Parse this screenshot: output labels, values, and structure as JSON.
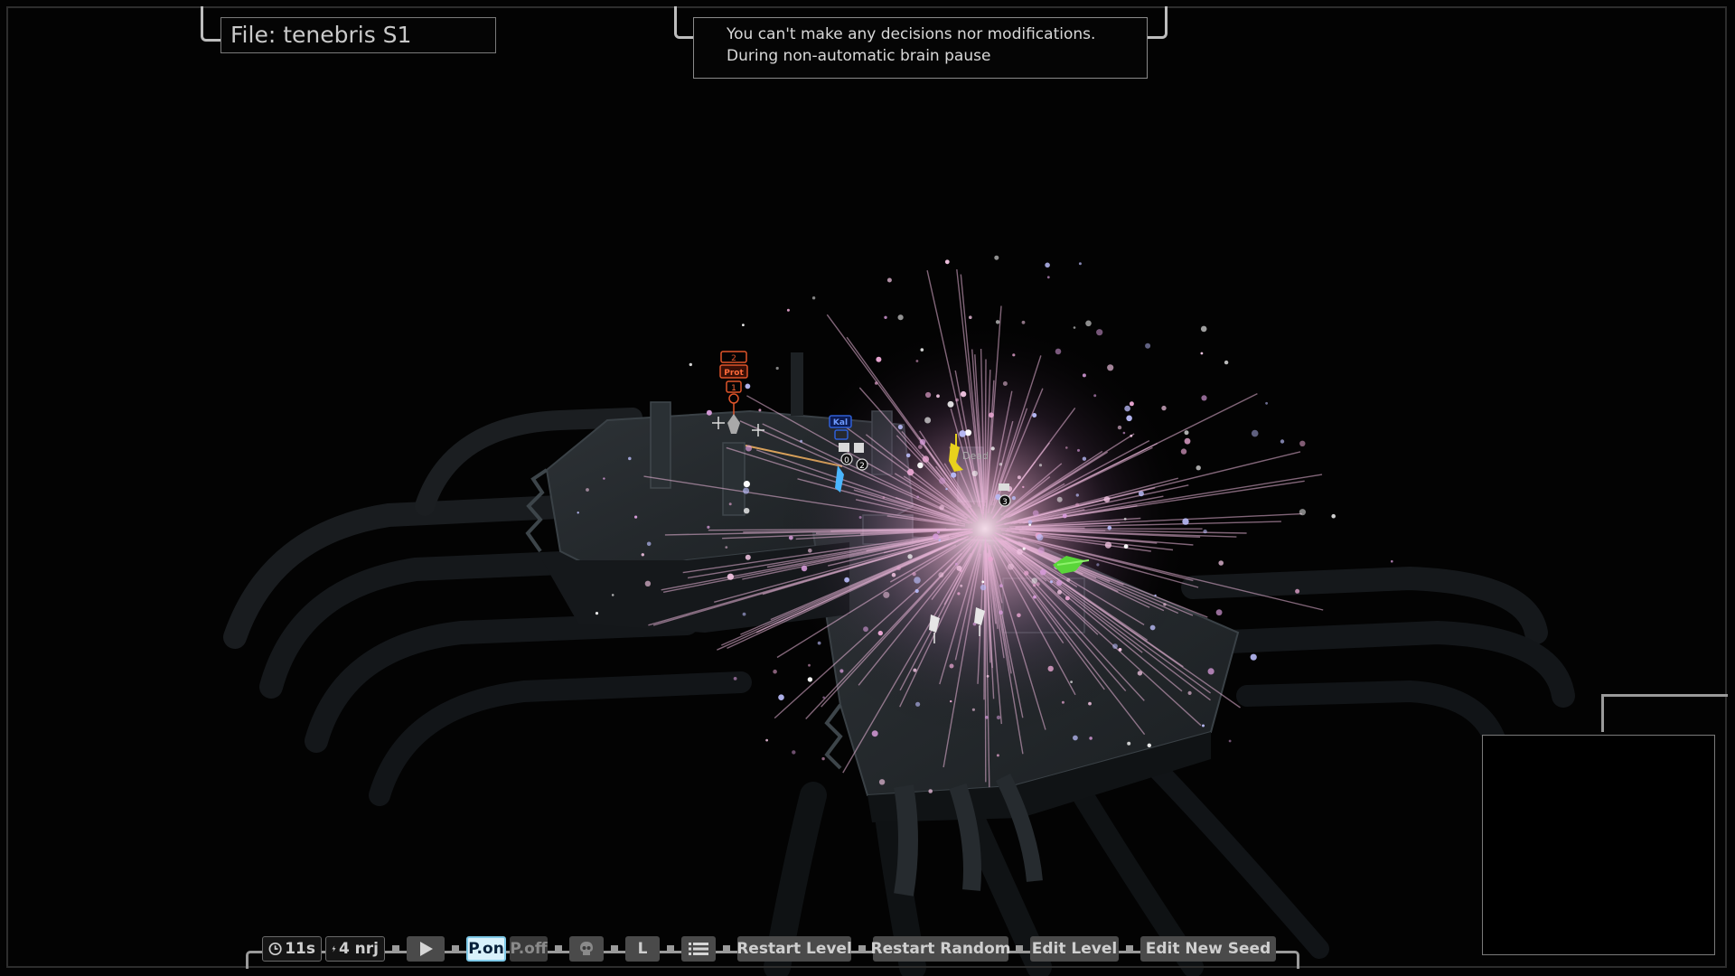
{
  "file_title": "File: tenebris S1",
  "message": {
    "line1": "You can't make any decisions nor modifications.",
    "line2": "During non-automatic brain pause"
  },
  "toolbar": {
    "time_label": "11s",
    "energy_label": "4 nrj",
    "play_icon": "play-icon",
    "pause_on_label": "P.on",
    "pause_off_label": "P.off",
    "skull_icon": "skull-icon",
    "l_label": "L",
    "list_icon": "list-icon",
    "restart_level_label": "Restart Level",
    "restart_random_label": "Restart Random",
    "edit_level_label": "Edit Level",
    "edit_new_seed_label": "Edit New Seed"
  },
  "units": {
    "enemy_tag": "Prot",
    "enemy_count": "1",
    "enemy_badge": "2",
    "ally_tag": "Kal",
    "ally_badge_a": "0",
    "ally_badge_b": "2",
    "unit_badge_3": "3",
    "dead_label": "Dead"
  },
  "colors": {
    "accent_active": "#d8f1fb",
    "enemy": "#e0542a",
    "ally": "#2f5fd6",
    "yellow_unit": "#e8d21c",
    "green_unit": "#5ad53a",
    "explosion": "#e9b7d8"
  }
}
